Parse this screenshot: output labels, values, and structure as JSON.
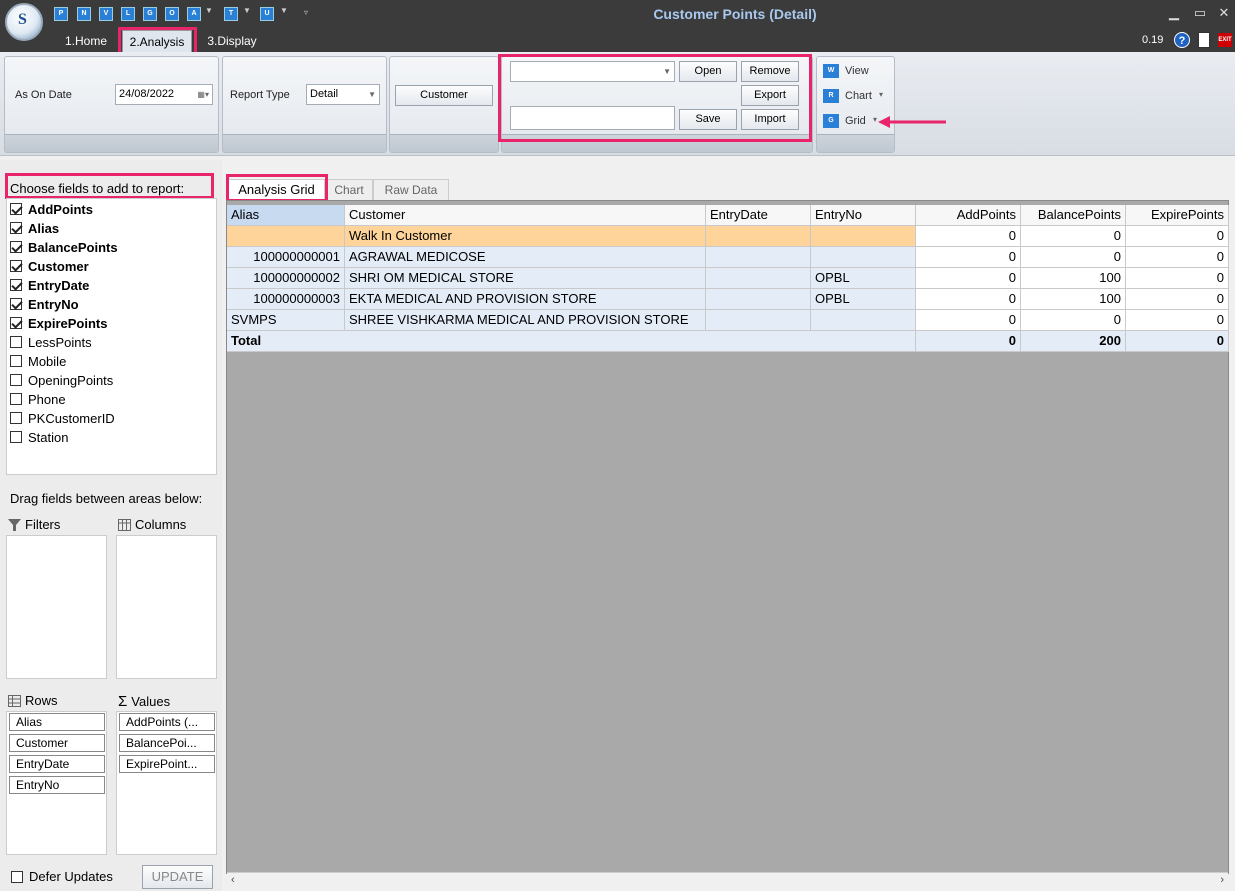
{
  "window": {
    "title": "Customer Points (Detail)",
    "version": "0.19"
  },
  "quick_access": [
    "P",
    "N",
    "V",
    "L",
    "G",
    "O",
    "A",
    "T",
    "U"
  ],
  "tabs": [
    {
      "label": "1.Home"
    },
    {
      "label": "2.Analysis"
    },
    {
      "label": "3.Display"
    }
  ],
  "ribbon": {
    "as_on_date_label": "As On Date",
    "as_on_date_value": "24/08/2022",
    "report_type_label": "Report Type",
    "report_type_value": "Detail",
    "customer_button": "Customer",
    "open_button": "Open",
    "remove_button": "Remove",
    "export_button": "Export",
    "save_button": "Save",
    "import_button": "Import",
    "view_label": "View",
    "chart_label": "Chart",
    "grid_label": "Grid"
  },
  "field_chooser": {
    "title": "Choose fields to add to report:",
    "fields": [
      {
        "name": "AddPoints",
        "checked": true
      },
      {
        "name": "Alias",
        "checked": true
      },
      {
        "name": "BalancePoints",
        "checked": true
      },
      {
        "name": "Customer",
        "checked": true
      },
      {
        "name": "EntryDate",
        "checked": true
      },
      {
        "name": "EntryNo",
        "checked": true
      },
      {
        "name": "ExpirePoints",
        "checked": true
      },
      {
        "name": "LessPoints",
        "checked": false
      },
      {
        "name": "Mobile",
        "checked": false
      },
      {
        "name": "OpeningPoints",
        "checked": false
      },
      {
        "name": "Phone",
        "checked": false
      },
      {
        "name": "PKCustomerID",
        "checked": false
      },
      {
        "name": "Station",
        "checked": false
      }
    ],
    "drag_hint": "Drag fields between areas below:",
    "filters_label": "Filters",
    "columns_label": "Columns",
    "rows_label": "Rows",
    "values_label": "Values",
    "rows": [
      "Alias",
      "Customer",
      "EntryDate",
      "EntryNo"
    ],
    "values": [
      "AddPoints (...",
      "BalancePoi...",
      "ExpirePoint..."
    ],
    "defer_label": "Defer Updates",
    "update_button": "UPDATE"
  },
  "view_tabs": [
    {
      "label": "Analysis Grid"
    },
    {
      "label": "Chart"
    },
    {
      "label": "Raw Data"
    }
  ],
  "grid": {
    "headers": [
      "Alias",
      "Customer",
      "EntryDate",
      "EntryNo",
      "AddPoints",
      "BalancePoints",
      "ExpirePoints"
    ],
    "rows": [
      [
        "",
        "Walk In Customer",
        "",
        "",
        "0",
        "0",
        "0"
      ],
      [
        "100000000001",
        "AGRAWAL MEDICOSE",
        "",
        "",
        "0",
        "0",
        "0"
      ],
      [
        "100000000002",
        "SHRI OM MEDICAL STORE",
        "",
        "OPBL",
        "0",
        "100",
        "0"
      ],
      [
        "100000000003",
        "EKTA MEDICAL AND PROVISION STORE",
        "",
        "OPBL",
        "0",
        "100",
        "0"
      ],
      [
        "SVMPS",
        "SHREE VISHKARMA MEDICAL AND PROVISION STORE",
        "",
        "",
        "0",
        "0",
        "0"
      ]
    ],
    "total": {
      "label": "Total",
      "values": [
        "0",
        "200",
        "0"
      ]
    }
  }
}
